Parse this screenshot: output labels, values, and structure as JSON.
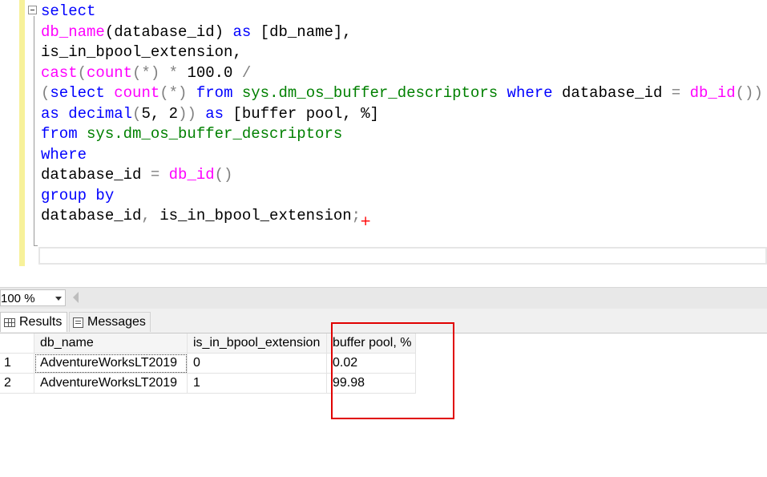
{
  "editor": {
    "lines": [
      [
        {
          "t": "select",
          "c": "kw"
        }
      ],
      [
        {
          "t": "db_name",
          "c": "fn"
        },
        {
          "t": "(database_id) ",
          "c": ""
        },
        {
          "t": "as",
          "c": "kw"
        },
        {
          "t": " [db_name],",
          "c": ""
        }
      ],
      [
        {
          "t": "is_in_bpool_extension,",
          "c": ""
        }
      ],
      [
        {
          "t": "cast",
          "c": "fn"
        },
        {
          "t": "(",
          "c": "op"
        },
        {
          "t": "count",
          "c": "fn"
        },
        {
          "t": "(*) * ",
          "c": "op"
        },
        {
          "t": "100.0",
          "c": ""
        },
        {
          "t": " /",
          "c": "op"
        }
      ],
      [
        {
          "t": "(",
          "c": "op"
        },
        {
          "t": "select",
          "c": "kw"
        },
        {
          "t": " ",
          "c": ""
        },
        {
          "t": "count",
          "c": "fn"
        },
        {
          "t": "(*) ",
          "c": "op"
        },
        {
          "t": "from",
          "c": "kw"
        },
        {
          "t": " ",
          "c": ""
        },
        {
          "t": "sys.dm_os_buffer_descriptors",
          "c": "sys"
        },
        {
          "t": " ",
          "c": ""
        },
        {
          "t": "where",
          "c": "kw"
        },
        {
          "t": " database_id ",
          "c": ""
        },
        {
          "t": "=",
          "c": "op"
        },
        {
          "t": " ",
          "c": ""
        },
        {
          "t": "db_id",
          "c": "fn"
        },
        {
          "t": "()",
          "c": "op"
        },
        {
          "t": ")",
          "c": "op"
        }
      ],
      [
        {
          "t": "as",
          "c": "kw"
        },
        {
          "t": " ",
          "c": ""
        },
        {
          "t": "decimal",
          "c": "kw"
        },
        {
          "t": "(",
          "c": "op"
        },
        {
          "t": "5, 2",
          "c": ""
        },
        {
          "t": "))",
          "c": "op"
        },
        {
          "t": " ",
          "c": ""
        },
        {
          "t": "as",
          "c": "kw"
        },
        {
          "t": " [buffer pool, %]",
          "c": ""
        }
      ],
      [
        {
          "t": "from",
          "c": "kw"
        },
        {
          "t": " ",
          "c": ""
        },
        {
          "t": "sys.dm_os_buffer_descriptors",
          "c": "sys"
        }
      ],
      [
        {
          "t": "where",
          "c": "kw"
        }
      ],
      [
        {
          "t": "database_id ",
          "c": ""
        },
        {
          "t": "=",
          "c": "op"
        },
        {
          "t": " ",
          "c": ""
        },
        {
          "t": "db_id",
          "c": "fn"
        },
        {
          "t": "()",
          "c": "op"
        }
      ],
      [
        {
          "t": "group by",
          "c": "kw"
        }
      ],
      [
        {
          "t": "database_id",
          "c": ""
        },
        {
          "t": ",",
          "c": "op"
        },
        {
          "t": " is_in_bpool_extension",
          "c": ""
        },
        {
          "t": ";",
          "c": "op"
        }
      ]
    ],
    "cursor_mark": "+"
  },
  "toolbar": {
    "zoom_value": "100 %"
  },
  "tabs": [
    {
      "label": "Results",
      "icon": "grid-icon"
    },
    {
      "label": "Messages",
      "icon": "messages-icon"
    }
  ],
  "results": {
    "columns": [
      "db_name",
      "is_in_bpool_extension",
      "buffer pool, %"
    ],
    "rows": [
      {
        "num": "1",
        "cells": [
          "AdventureWorksLT2019",
          "0",
          "0.02"
        ]
      },
      {
        "num": "2",
        "cells": [
          "AdventureWorksLT2019",
          "1",
          "99.98"
        ]
      }
    ]
  },
  "colors": {
    "keyword": "#0000ff",
    "function": "#ff00ff",
    "system_object": "#008000",
    "operator": "#808080",
    "highlight_box": "#e00000",
    "change_bar": "#f7f19a"
  }
}
